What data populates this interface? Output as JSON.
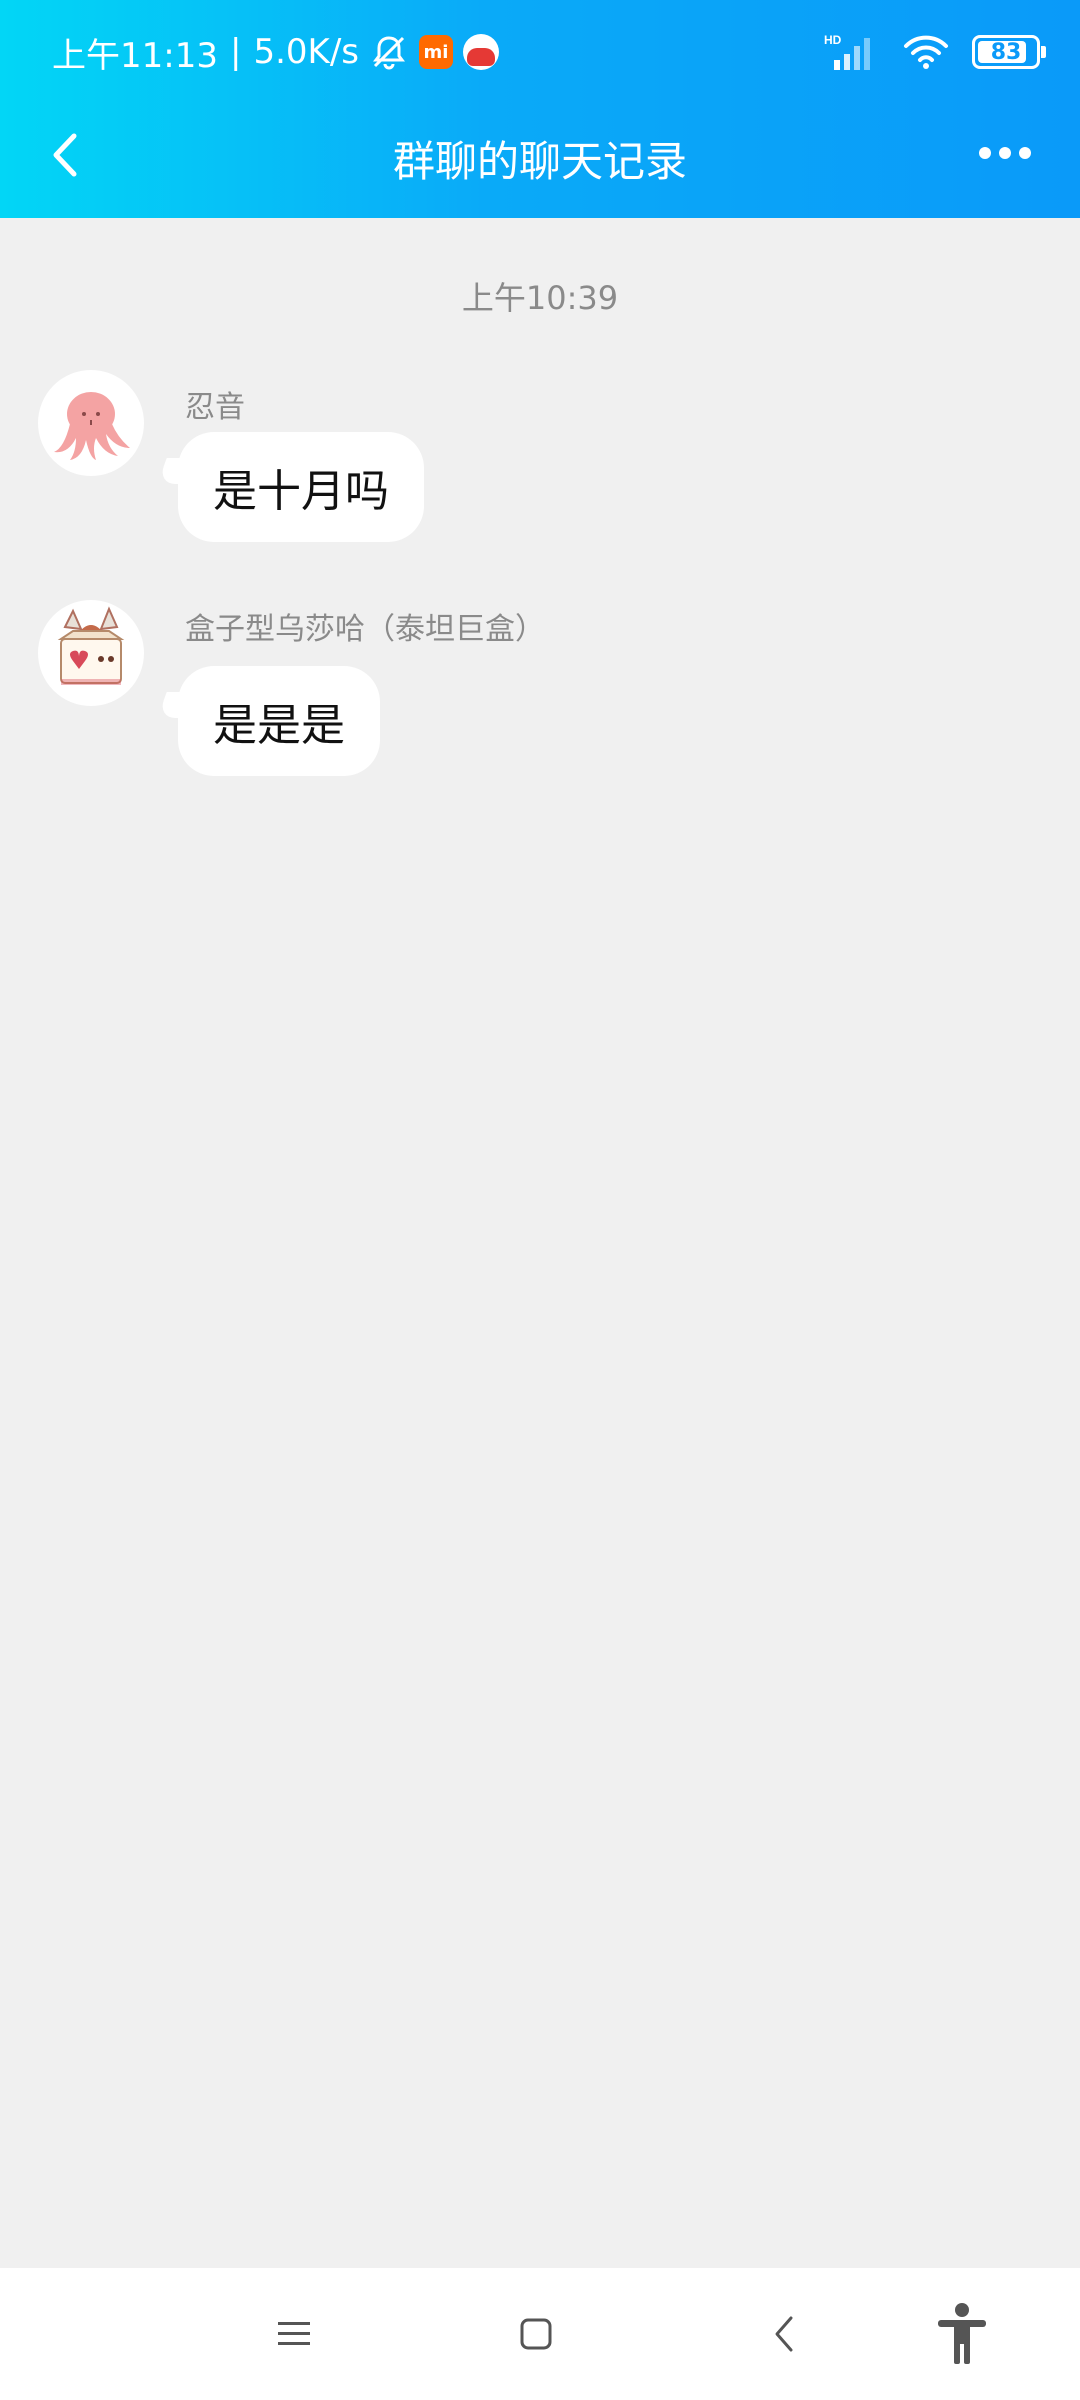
{
  "status_bar": {
    "time": "上午11:13",
    "separator": "|",
    "network_speed": "5.0K/s",
    "signal_label": "HD",
    "battery": "83",
    "icons": [
      "mute-bell-icon",
      "mi-app-icon",
      "red-app-icon",
      "signal-icon",
      "wifi-icon",
      "battery-icon"
    ]
  },
  "header": {
    "title": "群聊的聊天记录",
    "back_icon": "chevron-left-icon",
    "more_icon": "more-dots-icon",
    "colors": {
      "start": "#02d6f6",
      "end": "#0a9af9"
    }
  },
  "chat": {
    "timestamp": "上午10:39",
    "messages": [
      {
        "sender": "忍音",
        "text": "是十月吗",
        "avatar": "octopus-avatar"
      },
      {
        "sender": "盒子型乌莎哈（泰坦巨盒）",
        "text": "是是是",
        "avatar": "box-character-avatar"
      }
    ]
  },
  "system_nav": {
    "icons": [
      "menu-icon",
      "home-square-icon",
      "back-chevron-icon",
      "accessibility-icon"
    ]
  }
}
